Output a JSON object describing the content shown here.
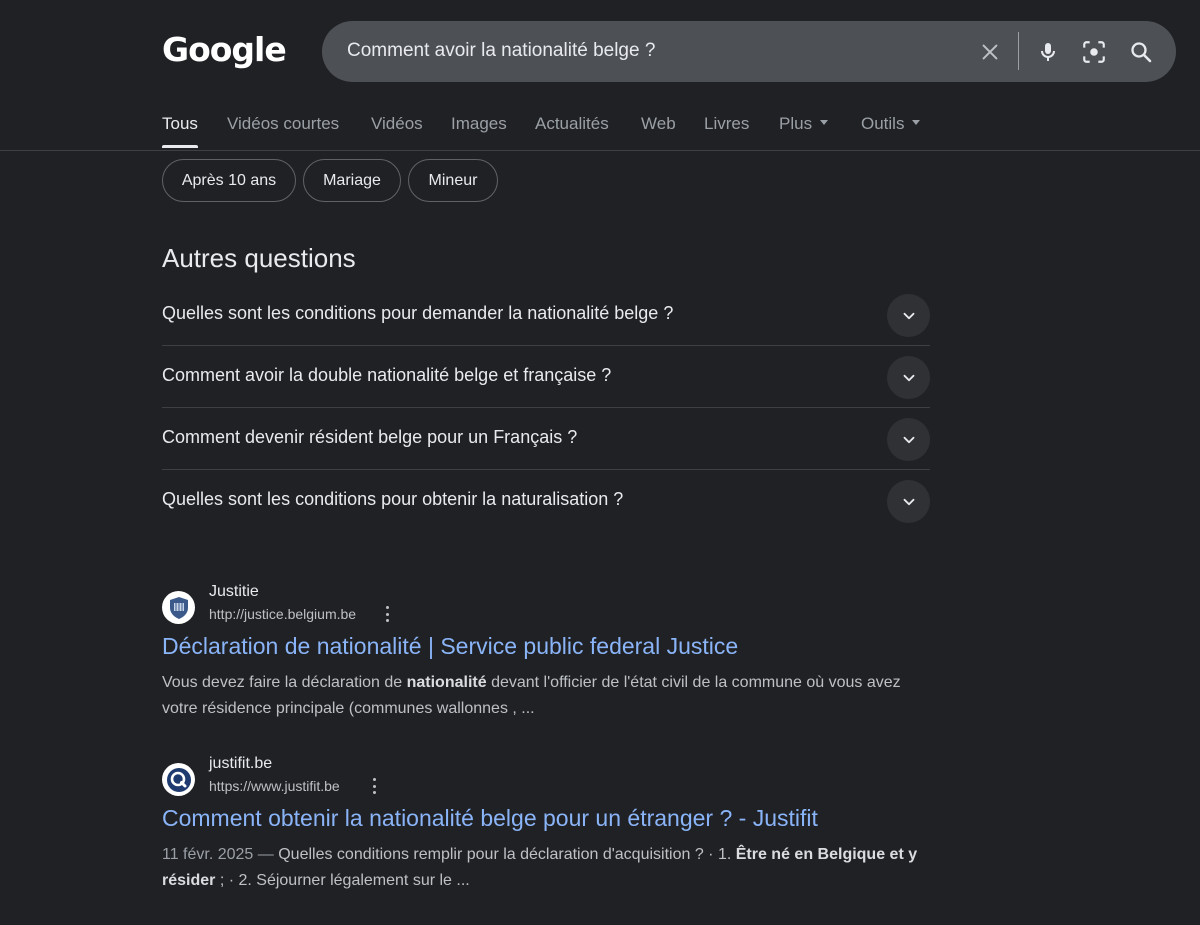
{
  "logo": {
    "text": "Google"
  },
  "search": {
    "query": "Comment avoir la nationalité belge ?"
  },
  "tabs": [
    {
      "label": "Tous"
    },
    {
      "label": "Vidéos courtes"
    },
    {
      "label": "Vidéos"
    },
    {
      "label": "Images"
    },
    {
      "label": "Actualités"
    },
    {
      "label": "Web"
    },
    {
      "label": "Livres"
    },
    {
      "label": "Plus"
    },
    {
      "label": "Outils"
    }
  ],
  "chips": [
    {
      "label": "Après 10 ans"
    },
    {
      "label": "Mariage"
    },
    {
      "label": "Mineur"
    }
  ],
  "people_also_ask": {
    "title": "Autres questions",
    "questions": [
      "Quelles sont les conditions pour demander la nationalité belge ?",
      "Comment avoir la double nationalité belge et française ?",
      "Comment devenir résident belge pour un Français ?",
      "Quelles sont les conditions pour obtenir la naturalisation ?"
    ]
  },
  "results": [
    {
      "site_name": "Justitie",
      "url": "http://justice.belgium.be",
      "title": "Déclaration de nationalité | Service public federal Justice",
      "snippet": {
        "part1": "Vous devez faire la déclaration de ",
        "bold1": "nationalité",
        "part2": " devant l'officier de l'état civil de la commune où vous avez votre résidence principale (communes wallonnes , ..."
      }
    },
    {
      "site_name": "justifit.be",
      "url": "https://www.justifit.be",
      "title": "Comment obtenir la nationalité belge pour un étranger ? - Justifit",
      "snippet": {
        "date": "11 févr. 2025 — ",
        "part1": "Quelles conditions remplir pour la déclaration d'acquisition ? · 1. ",
        "bold1": "Être né en Belgique et y résider",
        "part2": " ; · 2. Séjourner légalement sur le ..."
      }
    }
  ]
}
